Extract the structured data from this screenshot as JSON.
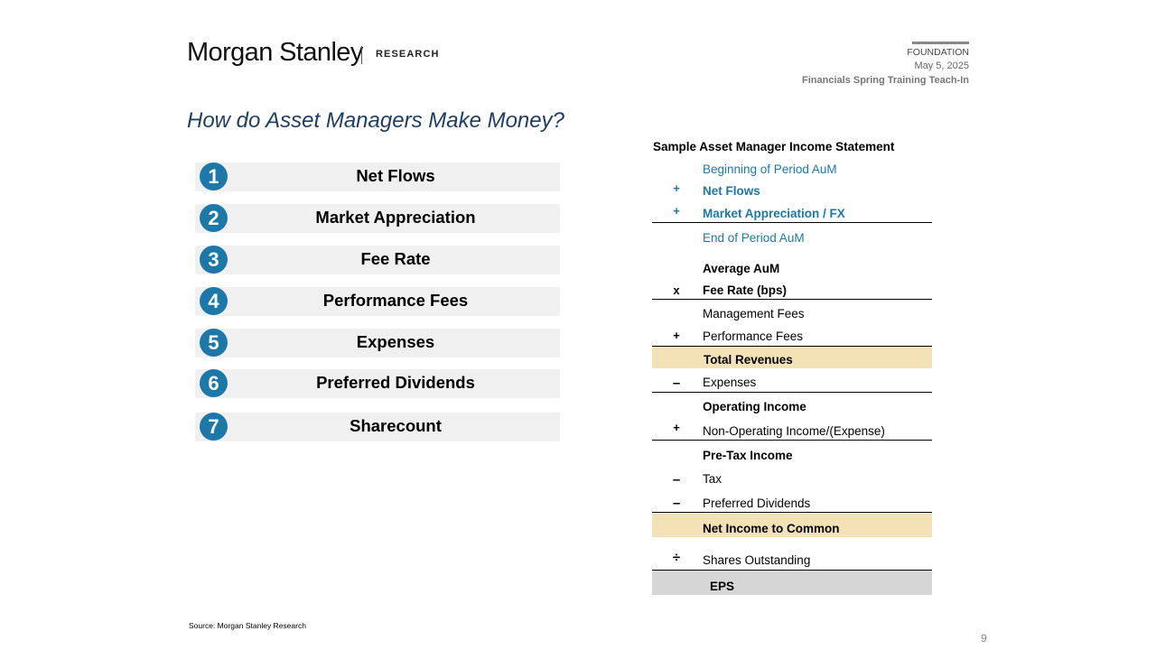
{
  "header": {
    "logo": "Morgan Stanley",
    "research": "RESEARCH",
    "foundation": "FOUNDATION",
    "date": "May 5, 2025",
    "event": "Financials Spring Training Teach-In"
  },
  "title": "How do Asset Managers Make Money?",
  "drivers": [
    {
      "num": "1",
      "label": "Net Flows"
    },
    {
      "num": "2",
      "label": "Market Appreciation"
    },
    {
      "num": "3",
      "label": "Fee Rate"
    },
    {
      "num": "4",
      "label": "Performance Fees"
    },
    {
      "num": "5",
      "label": "Expenses"
    },
    {
      "num": "6",
      "label": "Preferred Dividends"
    },
    {
      "num": "7",
      "label": "Sharecount"
    }
  ],
  "statement": {
    "title": "Sample Asset Manager Income Statement",
    "lines": [
      {
        "op": "",
        "label": "Beginning of Period AuM"
      },
      {
        "op": "+",
        "label": "Net Flows"
      },
      {
        "op": "+",
        "label": "Market Appreciation / FX"
      },
      {
        "op": "",
        "label": "End of Period AuM"
      },
      {
        "op": "",
        "label": "Average AuM"
      },
      {
        "op": "x",
        "label": "Fee Rate (bps)"
      },
      {
        "op": "",
        "label": "Management Fees"
      },
      {
        "op": "+",
        "label": "Performance Fees"
      },
      {
        "op": "",
        "label": "Total Revenues"
      },
      {
        "op": "–",
        "label": "Expenses"
      },
      {
        "op": "",
        "label": "Operating Income"
      },
      {
        "op": "+",
        "label": "Non-Operating Income/(Expense)"
      },
      {
        "op": "",
        "label": "Pre-Tax Income"
      },
      {
        "op": "–",
        "label": "Tax"
      },
      {
        "op": "–",
        "label": "Preferred Dividends"
      },
      {
        "op": "",
        "label": "Net Income to Common"
      },
      {
        "op": "÷",
        "label": "Shares Outstanding"
      },
      {
        "op": "",
        "label": "EPS"
      }
    ],
    "colors": {
      "blue": "#1c78a8",
      "highlight": "#f3e2b5",
      "eps": "#d6d6d6"
    }
  },
  "source": "Source: Morgan Stanley Research",
  "page_number": "9"
}
